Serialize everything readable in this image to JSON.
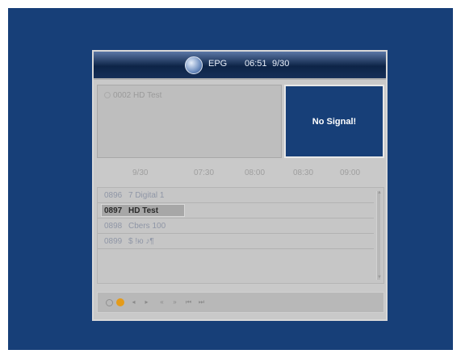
{
  "header": {
    "title": "EPG",
    "time": "06:51",
    "date": "9/30",
    "icon": "globe-icon"
  },
  "info": {
    "channel_label": "0002 HD Test"
  },
  "preview": {
    "status": "No Signal!"
  },
  "timeline": {
    "date": "9/30",
    "slots": [
      "07:30",
      "08:00",
      "08:30",
      "09:00"
    ]
  },
  "channels": [
    {
      "num": "0896",
      "name": "7 Digital 1",
      "selected": false
    },
    {
      "num": "0897",
      "name": "HD Test",
      "selected": true
    },
    {
      "num": "0898",
      "name": "Cbers 100",
      "selected": false
    },
    {
      "num": "0899",
      "name": "$ !ю ♪¶",
      "selected": false
    }
  ],
  "footer": {
    "buttons": [
      "search-icon",
      "ok-icon",
      "prev-icon",
      "next-icon",
      "rewind-icon",
      "fast-forward-icon",
      "skip-back-icon",
      "skip-forward-icon"
    ],
    "accent_color": "#e49b1a"
  },
  "colors": {
    "screen_bg": "#173f78",
    "panel_bg": "#c9c9c9"
  }
}
